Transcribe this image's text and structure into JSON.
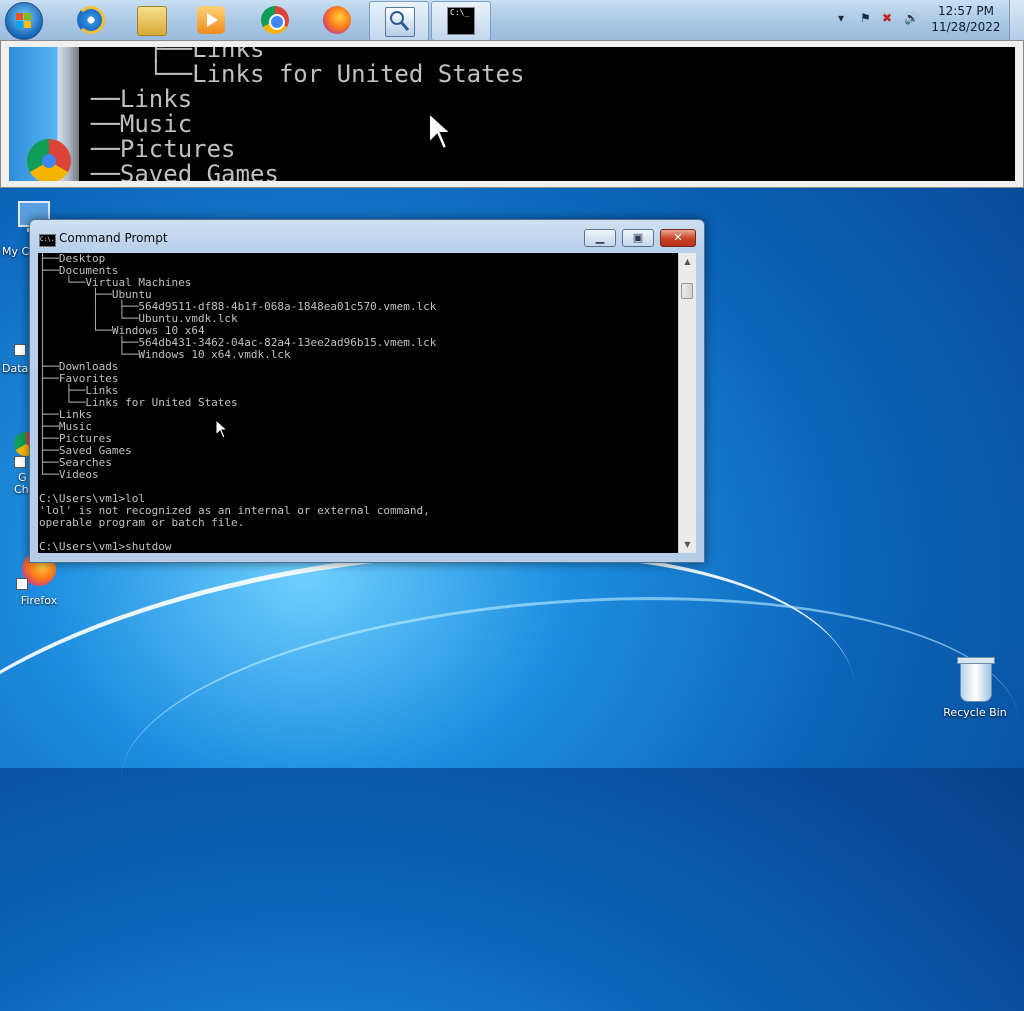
{
  "taskbar": {
    "clock_time": "12:57 PM",
    "clock_date": "11/28/2022",
    "apps": [
      "internet-explorer",
      "windows-explorer",
      "windows-media-player",
      "google-chrome",
      "firefox",
      "magnifier",
      "command-prompt"
    ],
    "cmd_icon_text": "C:\\_"
  },
  "magnifier": {
    "lines": [
      "    ├──Links",
      "    └──Links for United States",
      "──Links",
      "──Music",
      "──Pictures",
      "──Saved Games"
    ]
  },
  "desktop": {
    "icons": [
      {
        "label": "My C"
      },
      {
        "label": "Data"
      },
      {
        "label": "G"
      },
      {
        "label": "Ch"
      },
      {
        "label": "Firefox"
      },
      {
        "label": "Recycle Bin"
      }
    ]
  },
  "cmd": {
    "title": "Command Prompt",
    "icon_text": "C:\\.",
    "lines": [
      "├──Desktop",
      "├──Documents",
      "│   └──Virtual Machines",
      "│       ├──Ubuntu",
      "│       │   ├──564d9511-df88-4b1f-068a-1848ea01c570.vmem.lck",
      "│       │   └──Ubuntu.vmdk.lck",
      "│       └──Windows 10 x64",
      "│           ├──564db431-3462-04ac-82a4-13ee2ad96b15.vmem.lck",
      "│           └──Windows 10 x64.vmdk.lck",
      "├──Downloads",
      "├──Favorites",
      "│   ├──Links",
      "│   └──Links for United States",
      "├──Links",
      "├──Music",
      "├──Pictures",
      "├──Saved Games",
      "├──Searches",
      "└──Videos",
      "",
      "C:\\Users\\vm1>lol",
      "'lol' is not recognized as an internal or external command,",
      "operable program or batch file.",
      "",
      "C:\\Users\\vm1>shutdow"
    ]
  }
}
